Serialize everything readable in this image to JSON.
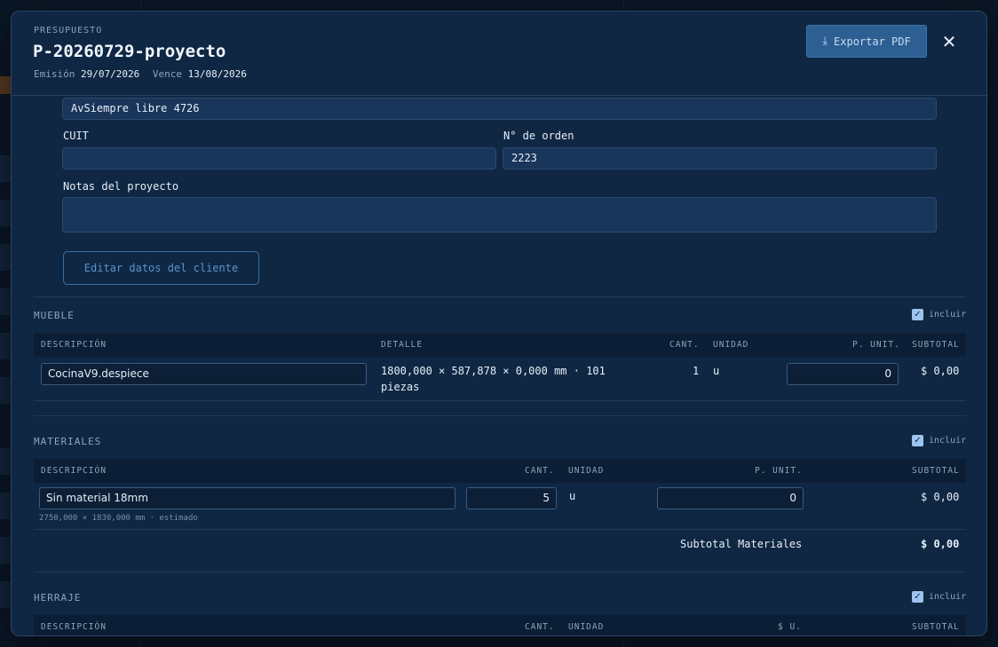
{
  "header": {
    "kicker": "PRESUPUESTO",
    "title": "P-20260729-proyecto",
    "emision_label": "Emisión",
    "emision_value": "29/07/2026",
    "vence_label": "Vence",
    "vence_value": "13/08/2026",
    "export_label": "Exportar PDF",
    "close_glyph": "✕",
    "download_glyph": "⤓"
  },
  "client": {
    "address_value": "AvSiempre libre 4726",
    "cuit_label": "CUIT",
    "cuit_value": "",
    "orden_label": "N° de orden",
    "orden_value": "2223",
    "notas_label": "Notas del proyecto",
    "notas_value": "",
    "edit_button": "Editar datos del cliente"
  },
  "include_label": "incluir",
  "check_glyph": "✓",
  "mueble": {
    "title": "MUEBLE",
    "headers": {
      "descripcion": "DESCRIPCIÓN",
      "detalle": "DETALLE",
      "cant": "CANT.",
      "unidad": "UNIDAD",
      "punit": "P. UNIT.",
      "subtotal": "SUBTOTAL"
    },
    "row": {
      "descripcion": "CocinaV9.despiece",
      "detalle_line1": "1800,000 × 587,878 × 0,000 mm · 101",
      "detalle_line2": "piezas",
      "cant": "1",
      "unidad": "u",
      "punit": "0",
      "subtotal": "$ 0,00"
    }
  },
  "materiales": {
    "title": "MATERIALES",
    "headers": {
      "descripcion": "DESCRIPCIÓN",
      "cant": "CANT.",
      "unidad": "UNIDAD",
      "punit": "P. UNIT.",
      "subtotal": "SUBTOTAL"
    },
    "row": {
      "descripcion": "Sin material 18mm",
      "note": "2750,000 × 1830,000 mm · estimado",
      "cant": "5",
      "unidad": "u",
      "punit": "0",
      "subtotal": "$ 0,00"
    },
    "subtotal_label": "Subtotal Materiales",
    "subtotal_value": "$ 0,00"
  },
  "herraje": {
    "title": "HERRAJE",
    "headers": {
      "descripcion": "DESCRIPCIÓN",
      "cant": "CANT.",
      "unidad": "UNIDAD",
      "pu": "$ U.",
      "subtotal": "SUBTOTAL"
    }
  }
}
